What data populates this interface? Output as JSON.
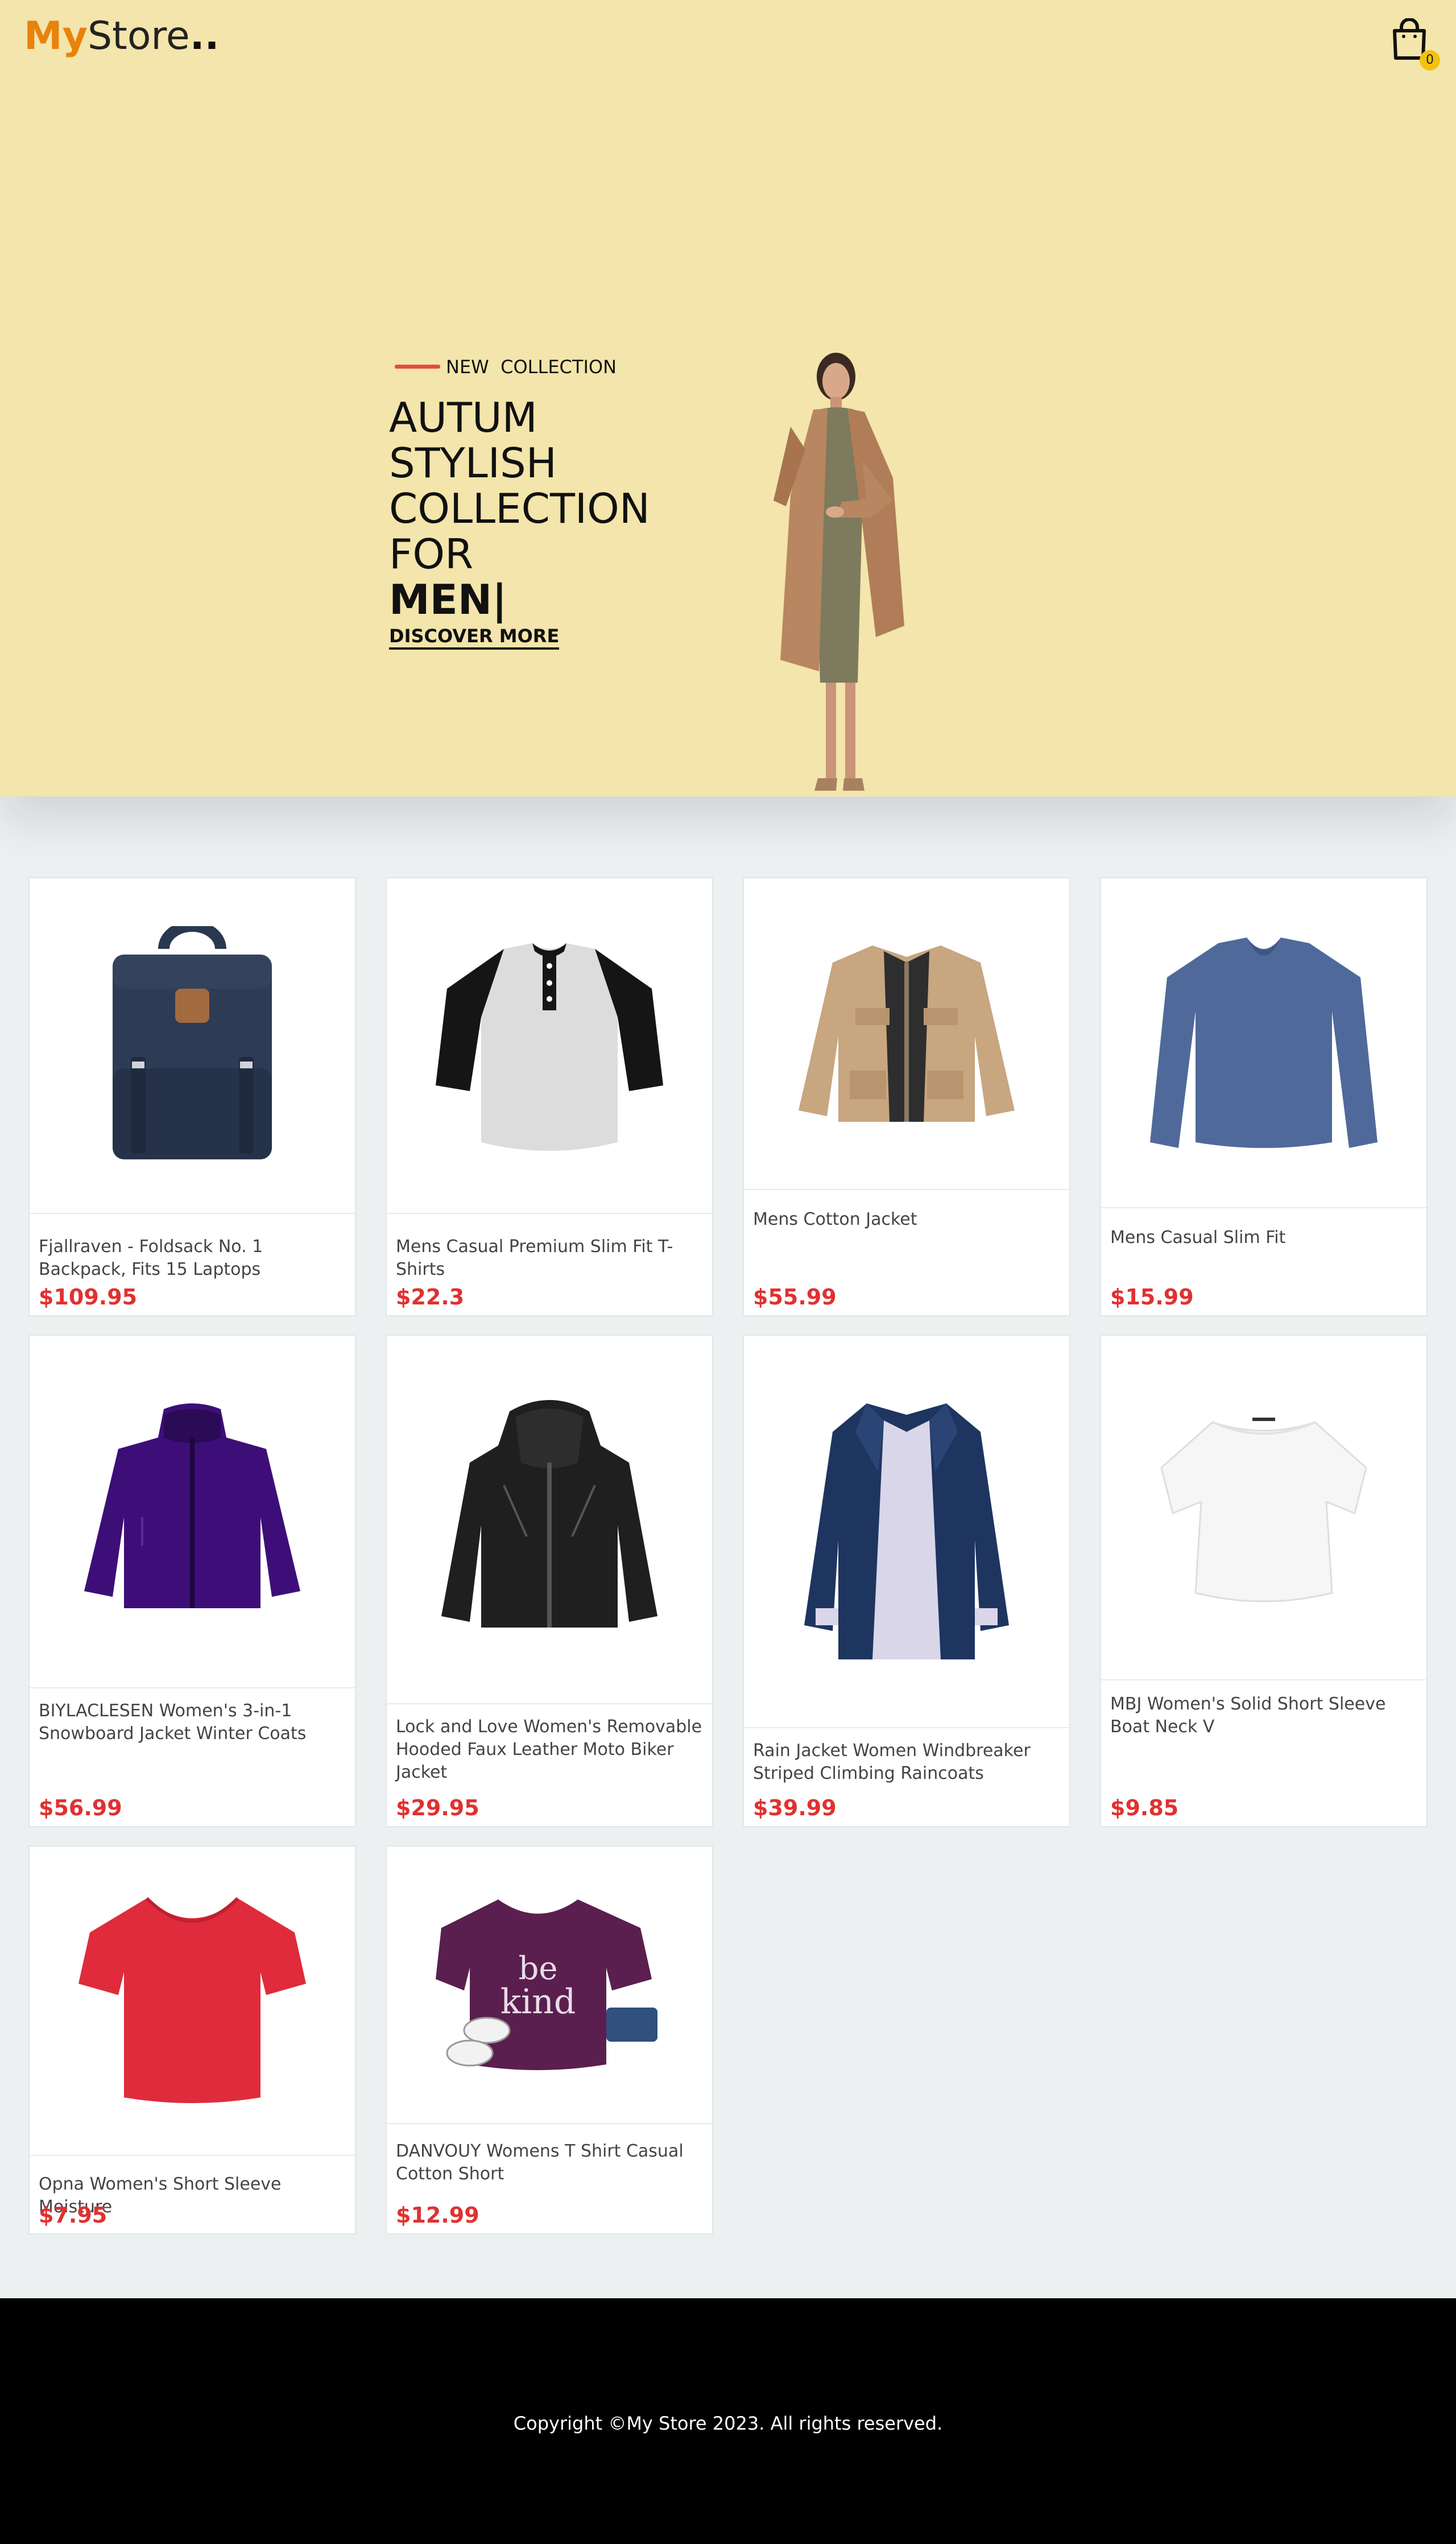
{
  "header": {
    "logo_my": "My",
    "logo_store": "Store",
    "logo_dots": "..",
    "cart_count": "0",
    "accent_color": "#e8820c"
  },
  "hero": {
    "eyebrow": "NEW  COLLECTION",
    "lines": [
      "AUTUM",
      "STYLISH",
      "COLLECTION",
      "FOR"
    ],
    "highlight": "MEN|",
    "cta": "DISCOVER MORE",
    "background": "#f3e5ab"
  },
  "products": [
    {
      "title": "Fjallraven - Foldsack No. 1 Backpack, Fits 15 Laptops",
      "price": "$109.95",
      "icon": "backpack-icon"
    },
    {
      "title": "Mens Casual Premium Slim Fit T-Shirts",
      "price": "$22.3",
      "icon": "henley-shirt-icon"
    },
    {
      "title": "Mens Cotton Jacket",
      "price": "$55.99",
      "icon": "cotton-jacket-icon"
    },
    {
      "title": "Mens Casual Slim Fit",
      "price": "$15.99",
      "icon": "longsleeve-shirt-icon"
    },
    {
      "title": "BIYLACLESEN Women's 3-in-1 Snowboard Jacket Winter Coats",
      "price": "$56.99",
      "icon": "snowboard-jacket-icon"
    },
    {
      "title": "Lock and Love Women's Removable Hooded Faux Leather Moto Biker Jacket",
      "price": "$29.95",
      "icon": "leather-jacket-icon"
    },
    {
      "title": "Rain Jacket Women Windbreaker Striped Climbing Raincoats",
      "price": "$39.99",
      "icon": "rain-jacket-icon"
    },
    {
      "title": "MBJ Women's Solid Short Sleeve Boat Neck V",
      "price": "$9.85",
      "icon": "white-top-icon"
    },
    {
      "title": "Opna Women's Short Sleeve Moisture",
      "price": "$7.95",
      "icon": "red-tshirt-icon"
    },
    {
      "title": "DANVOUY Womens T Shirt Casual Cotton Short",
      "price": "$12.99",
      "icon": "purple-tshirt-icon"
    }
  ],
  "footer": {
    "copyright": "Copyright ©My Store 2023. All rights reserved."
  },
  "price_color": "#e0312f"
}
